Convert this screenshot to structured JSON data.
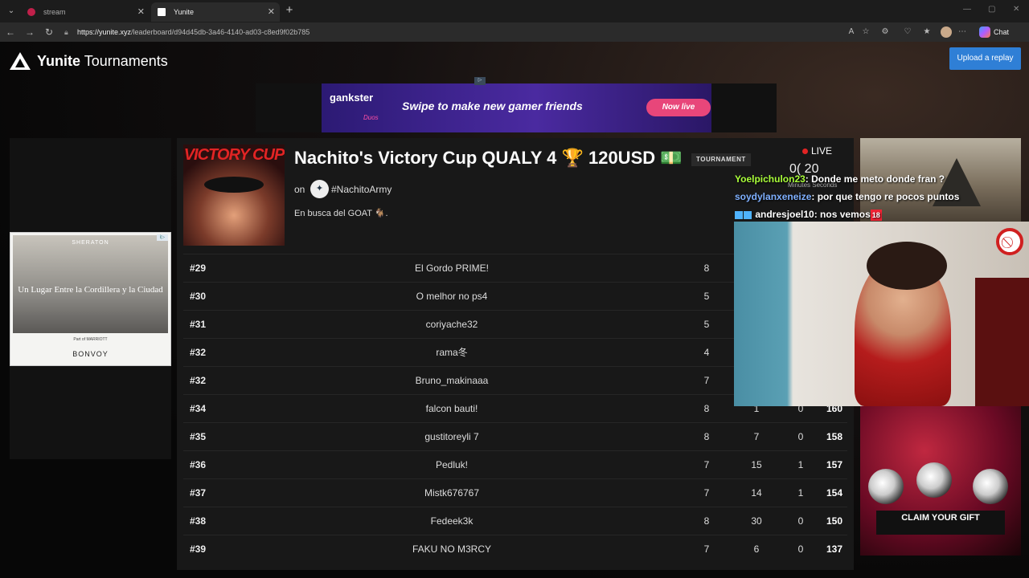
{
  "browser": {
    "tabs": [
      {
        "label": "stream",
        "favicon_color": "#c0204a"
      },
      {
        "label": "Yunite",
        "favicon_color": "#ffffff"
      }
    ],
    "url_host": "https://yunite.xyz",
    "url_path": "/leaderboard/d94d45db-3a46-4140-ad03-c8ed9f02b785",
    "chat_label": "Chat"
  },
  "header": {
    "brand_bold": "Yunite",
    "brand_rest": " Tournaments",
    "upload_label": "Upload a replay"
  },
  "top_ad": {
    "logo": "gankster",
    "logo_sub": "Duos",
    "headline": "Swipe to make new gamer friends",
    "cta": "Now live"
  },
  "left_ad": {
    "brand": "SHERATON",
    "text": "Un Lugar Entre la Cordillera y la Ciudad",
    "part_of": "Part of MARRIOTT",
    "bonvoy": "BONVOY"
  },
  "tournament": {
    "thumb_text": "VICTORY CUP",
    "title": "Nachito's Victory Cup QUALY 4 🏆 120USD 💵",
    "tag": "TOURNAMENT",
    "on_label": "on",
    "org": "#NachitoArmy",
    "description": "En busca del GOAT 🐐.",
    "live_label": "LIVE",
    "timer": "0( 20",
    "timer_labels": "Minutes   Seconds"
  },
  "leaderboard": {
    "rows": [
      {
        "rank": "#29",
        "name": "El Gordo PRIME!",
        "c1": "8",
        "c2": "",
        "c3": "",
        "pts": ""
      },
      {
        "rank": "#30",
        "name": "O melhor no ps4",
        "c1": "5",
        "c2": "",
        "c3": "",
        "pts": ""
      },
      {
        "rank": "#31",
        "name": "coriyache32",
        "c1": "5",
        "c2": "",
        "c3": "",
        "pts": ""
      },
      {
        "rank": "#32",
        "name": "rama冬",
        "c1": "4",
        "c2": "",
        "c3": "",
        "pts": ""
      },
      {
        "rank": "#32",
        "name": "Bruno_makinaaa",
        "c1": "7",
        "c2": "",
        "c3": "",
        "pts": ""
      },
      {
        "rank": "#34",
        "name": "falcon bauti!",
        "c1": "8",
        "c2": "1",
        "c3": "0",
        "pts": "160"
      },
      {
        "rank": "#35",
        "name": "gustitoreyli 7",
        "c1": "8",
        "c2": "7",
        "c3": "0",
        "pts": "158"
      },
      {
        "rank": "#36",
        "name": "Pedluk!",
        "c1": "7",
        "c2": "15",
        "c3": "1",
        "pts": "157"
      },
      {
        "rank": "#37",
        "name": "Mistk676767",
        "c1": "7",
        "c2": "14",
        "c3": "1",
        "pts": "154"
      },
      {
        "rank": "#38",
        "name": "Fedeek3k",
        "c1": "8",
        "c2": "30",
        "c3": "0",
        "pts": "150"
      },
      {
        "rank": "#39",
        "name": "FAKU NO M3RCY",
        "c1": "7",
        "c2": "6",
        "c3": "0",
        "pts": "137"
      }
    ]
  },
  "stream_chat": [
    {
      "user": "Yoelpichulon23",
      "text": ": Donde me meto donde fran ?",
      "color": "#aaff3a"
    },
    {
      "user": "soydylanxeneize",
      "text": ": por que tengo re pocos puntos",
      "color": "#7fb0ff"
    },
    {
      "user": "andresjoel10",
      "text": ": nos vemos",
      "badge": "18",
      "color": "#ffffff"
    }
  ],
  "right_ad": {
    "cta": "CLAIM YOUR GIFT"
  }
}
